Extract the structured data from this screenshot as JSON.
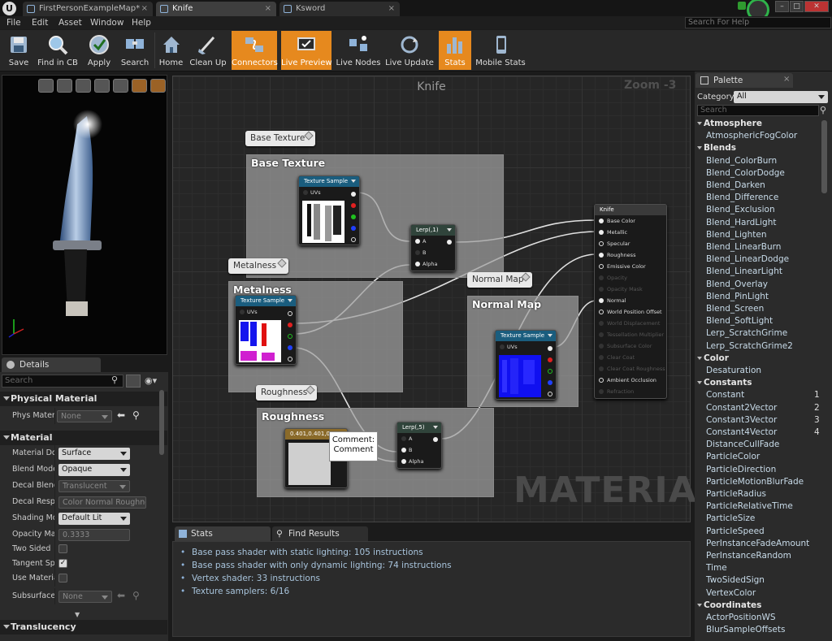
{
  "tabs": [
    {
      "label": "FirstPersonExampleMap*"
    },
    {
      "label": "Knife"
    },
    {
      "label": "Ksword"
    }
  ],
  "menu": [
    "File",
    "Edit",
    "Asset",
    "Window",
    "Help"
  ],
  "help_search_placeholder": "Search For Help",
  "toolbar": [
    {
      "label": "Save",
      "icon": "save-icon",
      "active": false
    },
    {
      "label": "Find in CB",
      "icon": "find-in-cb-icon",
      "active": false
    },
    {
      "label": "Apply",
      "icon": "apply-icon",
      "active": false
    },
    {
      "label": "Search",
      "icon": "search-icon",
      "active": false
    },
    {
      "label": "Home",
      "icon": "home-icon",
      "active": false
    },
    {
      "label": "Clean Up",
      "icon": "clean-up-icon",
      "active": false
    },
    {
      "label": "Connectors",
      "icon": "connectors-icon",
      "active": true
    },
    {
      "label": "Live Preview",
      "icon": "live-preview-icon",
      "active": true
    },
    {
      "label": "Live Nodes",
      "icon": "live-nodes-icon",
      "active": false
    },
    {
      "label": "Live Update",
      "icon": "live-update-icon",
      "active": false
    },
    {
      "label": "Stats",
      "icon": "stats-icon",
      "active": true
    },
    {
      "label": "Mobile Stats",
      "icon": "mobile-stats-icon",
      "active": false
    }
  ],
  "details": {
    "tab_label": "Details",
    "search_placeholder": "Search",
    "sections": {
      "physical": "Physical Material",
      "material": "Material",
      "translucency": "Translucency"
    },
    "rows": [
      {
        "label": "Phys Materia",
        "value": "None"
      },
      {
        "label": "Material Don",
        "value": "Surface"
      },
      {
        "label": "Blend Mode",
        "value": "Opaque"
      },
      {
        "label": "Decal Blend M",
        "value": "Translucent"
      },
      {
        "label": "Decal Respor",
        "value": "Color Normal Roughne"
      },
      {
        "label": "Shading Mod",
        "value": "Default Lit"
      },
      {
        "label": "Opacity Mas",
        "value": "0.3333"
      },
      {
        "label": "Two Sided",
        "checked": false
      },
      {
        "label": "Tangent Spa",
        "checked": true
      },
      {
        "label": "Use Material",
        "checked": false
      },
      {
        "label": "Subsurface P",
        "value": "None"
      }
    ]
  },
  "graph": {
    "title": "Knife",
    "zoom": "Zoom -3",
    "watermark": "MATERIAL",
    "comments": {
      "base_texture": {
        "bubble": "Base Texture",
        "header": "Base Texture"
      },
      "metalness": {
        "bubble": "Metalness",
        "header": "Metalness"
      },
      "normal_map": {
        "bubble": "Normal Map",
        "header": "Normal Map"
      },
      "roughness": {
        "bubble": "Roughness",
        "header": "Roughness"
      }
    },
    "nodes": {
      "texture_sample_title": "Texture Sample",
      "uvs_label": "UVs",
      "lerp1_title": "Lerp(,1)",
      "lerp2_title": "Lerp(,5)",
      "lerp_pins": [
        "A",
        "B",
        "Alpha"
      ],
      "constant_title": "0.401,0.401,0.401",
      "comment_tooltip": [
        "Comment:",
        "Comment"
      ]
    },
    "result_node": {
      "title": "Knife",
      "pins": [
        {
          "label": "Base Color",
          "enabled": true
        },
        {
          "label": "Metallic",
          "enabled": true
        },
        {
          "label": "Specular",
          "enabled": true
        },
        {
          "label": "Roughness",
          "enabled": true
        },
        {
          "label": "Emissive Color",
          "enabled": true
        },
        {
          "label": "Opacity",
          "enabled": false
        },
        {
          "label": "Opacity Mask",
          "enabled": false
        },
        {
          "label": "Normal",
          "enabled": true
        },
        {
          "label": "World Position Offset",
          "enabled": true
        },
        {
          "label": "World Displacement",
          "enabled": false
        },
        {
          "label": "Tessellation Multiplier",
          "enabled": false
        },
        {
          "label": "Subsurface Color",
          "enabled": false
        },
        {
          "label": "Clear Coat",
          "enabled": false
        },
        {
          "label": "Clear Coat Roughness",
          "enabled": false
        },
        {
          "label": "Ambient Occlusion",
          "enabled": true
        },
        {
          "label": "Refraction",
          "enabled": false
        }
      ]
    }
  },
  "bottom_tabs": [
    "Stats",
    "Find Results"
  ],
  "stats": [
    "Base pass shader with static lighting: 105 instructions",
    "Base pass shader with only dynamic lighting: 74 instructions",
    "Vertex shader: 33 instructions",
    "Texture samplers: 6/16"
  ],
  "palette": {
    "tab_label": "Palette",
    "category_label": "Category:",
    "category_value": "All",
    "search_placeholder": "Search",
    "list": [
      {
        "type": "cat",
        "label": "Atmosphere"
      },
      {
        "type": "item",
        "label": "AtmosphericFogColor"
      },
      {
        "type": "cat",
        "label": "Blends"
      },
      {
        "type": "item",
        "label": "Blend_ColorBurn"
      },
      {
        "type": "item",
        "label": "Blend_ColorDodge"
      },
      {
        "type": "item",
        "label": "Blend_Darken"
      },
      {
        "type": "item",
        "label": "Blend_Difference"
      },
      {
        "type": "item",
        "label": "Blend_Exclusion"
      },
      {
        "type": "item",
        "label": "Blend_HardLight"
      },
      {
        "type": "item",
        "label": "Blend_Lighten"
      },
      {
        "type": "item",
        "label": "Blend_LinearBurn"
      },
      {
        "type": "item",
        "label": "Blend_LinearDodge"
      },
      {
        "type": "item",
        "label": "Blend_LinearLight"
      },
      {
        "type": "item",
        "label": "Blend_Overlay"
      },
      {
        "type": "item",
        "label": "Blend_PinLight"
      },
      {
        "type": "item",
        "label": "Blend_Screen"
      },
      {
        "type": "item",
        "label": "Blend_SoftLight"
      },
      {
        "type": "item",
        "label": "Lerp_ScratchGrime"
      },
      {
        "type": "item",
        "label": "Lerp_ScratchGrime2"
      },
      {
        "type": "cat",
        "label": "Color"
      },
      {
        "type": "item",
        "label": "Desaturation"
      },
      {
        "type": "cat",
        "label": "Constants"
      },
      {
        "type": "item",
        "label": "Constant",
        "num": "1"
      },
      {
        "type": "item",
        "label": "Constant2Vector",
        "num": "2"
      },
      {
        "type": "item",
        "label": "Constant3Vector",
        "num": "3"
      },
      {
        "type": "item",
        "label": "Constant4Vector",
        "num": "4"
      },
      {
        "type": "item",
        "label": "DistanceCullFade"
      },
      {
        "type": "item",
        "label": "ParticleColor"
      },
      {
        "type": "item",
        "label": "ParticleDirection"
      },
      {
        "type": "item",
        "label": "ParticleMotionBlurFade"
      },
      {
        "type": "item",
        "label": "ParticleRadius"
      },
      {
        "type": "item",
        "label": "ParticleRelativeTime"
      },
      {
        "type": "item",
        "label": "ParticleSize"
      },
      {
        "type": "item",
        "label": "ParticleSpeed"
      },
      {
        "type": "item",
        "label": "PerInstanceFadeAmount"
      },
      {
        "type": "item",
        "label": "PerInstanceRandom"
      },
      {
        "type": "item",
        "label": "Time"
      },
      {
        "type": "item",
        "label": "TwoSidedSign"
      },
      {
        "type": "item",
        "label": "VertexColor"
      },
      {
        "type": "cat",
        "label": "Coordinates"
      },
      {
        "type": "item",
        "label": "ActorPositionWS"
      },
      {
        "type": "item",
        "label": "BlurSampleOffsets"
      }
    ]
  },
  "colors": {
    "accent": "#e6891e",
    "texture_node_header": "#1a5d7e",
    "lerp_node_header": "#30443b",
    "pin_red": "#e02020",
    "pin_green": "#20c020",
    "pin_blue": "#2040ff"
  }
}
